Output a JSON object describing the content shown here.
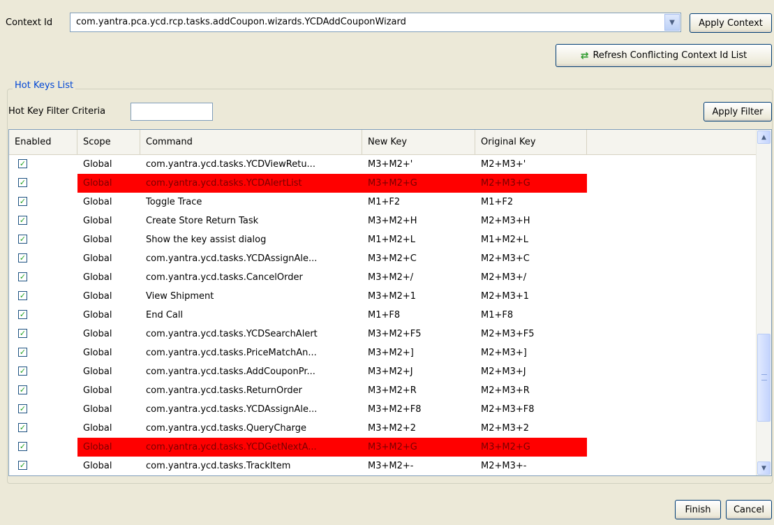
{
  "context": {
    "label": "Context Id",
    "value": "com.yantra.pca.ycd.rcp.tasks.addCoupon.wizards.YCDAddCouponWizard",
    "apply_label": "Apply Context",
    "refresh_label": "Refresh Conflicting Context Id List"
  },
  "group": {
    "title": "Hot Keys List",
    "filter_label": "Hot Key Filter Criteria",
    "filter_value": "",
    "apply_filter_label": "Apply Filter"
  },
  "table": {
    "columns": [
      "Enabled",
      "Scope",
      "Command",
      "New Key",
      "Original Key"
    ],
    "highlight_color": "#ff0000",
    "rows": [
      {
        "enabled": true,
        "scope": "Global",
        "command": "com.yantra.ycd.tasks.YCDViewRetu...",
        "new_key": "M3+M2+'",
        "original_key": "M2+M3+'",
        "conflict": false
      },
      {
        "enabled": true,
        "scope": "Global",
        "command": "com.yantra.ycd.tasks.YCDAlertList",
        "new_key": "M3+M2+G",
        "original_key": "M2+M3+G",
        "conflict": true
      },
      {
        "enabled": true,
        "scope": "Global",
        "command": "Toggle Trace",
        "new_key": "M1+F2",
        "original_key": "M1+F2",
        "conflict": false
      },
      {
        "enabled": true,
        "scope": "Global",
        "command": "Create Store Return Task",
        "new_key": "M3+M2+H",
        "original_key": "M2+M3+H",
        "conflict": false
      },
      {
        "enabled": true,
        "scope": "Global",
        "command": "Show the key assist dialog",
        "new_key": "M1+M2+L",
        "original_key": "M1+M2+L",
        "conflict": false
      },
      {
        "enabled": true,
        "scope": "Global",
        "command": "com.yantra.ycd.tasks.YCDAssignAle...",
        "new_key": "M3+M2+C",
        "original_key": "M2+M3+C",
        "conflict": false
      },
      {
        "enabled": true,
        "scope": "Global",
        "command": "com.yantra.ycd.tasks.CancelOrder",
        "new_key": "M3+M2+/",
        "original_key": "M2+M3+/",
        "conflict": false
      },
      {
        "enabled": true,
        "scope": "Global",
        "command": "View Shipment",
        "new_key": "M3+M2+1",
        "original_key": "M2+M3+1",
        "conflict": false
      },
      {
        "enabled": true,
        "scope": "Global",
        "command": "End Call",
        "new_key": "M1+F8",
        "original_key": "M1+F8",
        "conflict": false
      },
      {
        "enabled": true,
        "scope": "Global",
        "command": "com.yantra.ycd.tasks.YCDSearchAlert",
        "new_key": "M3+M2+F5",
        "original_key": "M2+M3+F5",
        "conflict": false
      },
      {
        "enabled": true,
        "scope": "Global",
        "command": "com.yantra.ycd.tasks.PriceMatchAn...",
        "new_key": "M3+M2+]",
        "original_key": "M2+M3+]",
        "conflict": false
      },
      {
        "enabled": true,
        "scope": "Global",
        "command": "com.yantra.ycd.tasks.AddCouponPr...",
        "new_key": "M3+M2+J",
        "original_key": "M2+M3+J",
        "conflict": false
      },
      {
        "enabled": true,
        "scope": "Global",
        "command": "com.yantra.ycd.tasks.ReturnOrder",
        "new_key": "M3+M2+R",
        "original_key": "M2+M3+R",
        "conflict": false
      },
      {
        "enabled": true,
        "scope": "Global",
        "command": "com.yantra.ycd.tasks.YCDAssignAle...",
        "new_key": "M3+M2+F8",
        "original_key": "M2+M3+F8",
        "conflict": false
      },
      {
        "enabled": true,
        "scope": "Global",
        "command": "com.yantra.ycd.tasks.QueryCharge",
        "new_key": "M3+M2+2",
        "original_key": "M2+M3+2",
        "conflict": false
      },
      {
        "enabled": true,
        "scope": "Global",
        "command": "com.yantra.ycd.tasks.YCDGetNextA...",
        "new_key": "M3+M2+G",
        "original_key": "M3+M2+G",
        "conflict": true
      },
      {
        "enabled": true,
        "scope": "Global",
        "command": "com.yantra.ycd.tasks.TrackItem",
        "new_key": "M3+M2+-",
        "original_key": "M2+M3+-",
        "conflict": false
      }
    ]
  },
  "footer": {
    "finish_label": "Finish",
    "cancel_label": "Cancel"
  }
}
